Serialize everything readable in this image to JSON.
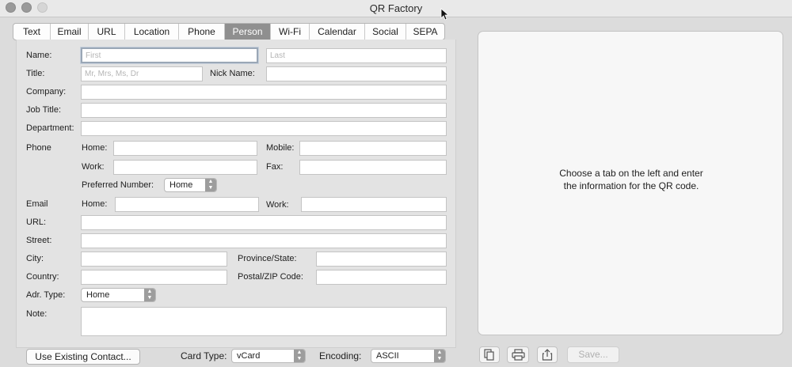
{
  "window": {
    "title": "QR Factory"
  },
  "tabs": [
    "Text",
    "Email",
    "URL",
    "Location",
    "Phone",
    "Person",
    "Wi-Fi",
    "Calendar",
    "Social",
    "SEPA"
  ],
  "selected_tab": "Person",
  "form": {
    "name_label": "Name:",
    "first_placeholder": "First",
    "last_placeholder": "Last",
    "title_label": "Title:",
    "title_placeholder": "Mr, Mrs, Ms, Dr",
    "nickname_label": "Nick Name:",
    "company_label": "Company:",
    "jobtitle_label": "Job Title:",
    "department_label": "Department:",
    "phone_label": "Phone",
    "phone_home_label": "Home:",
    "phone_mobile_label": "Mobile:",
    "phone_work_label": "Work:",
    "phone_fax_label": "Fax:",
    "preferred_label": "Preferred Number:",
    "preferred_value": "Home",
    "email_label": "Email",
    "email_home_label": "Home:",
    "email_work_label": "Work:",
    "url_label": "URL:",
    "street_label": "Street:",
    "city_label": "City:",
    "province_label": "Province/State:",
    "country_label": "Country:",
    "postal_label": "Postal/ZIP Code:",
    "adrtype_label": "Adr. Type:",
    "adrtype_value": "Home",
    "note_label": "Note:"
  },
  "footer": {
    "use_contact_label": "Use Existing Contact...",
    "card_type_label": "Card Type:",
    "card_type_value": "vCard",
    "encoding_label": "Encoding:",
    "encoding_value": "ASCII"
  },
  "preview": {
    "message_line1": "Choose a tab on the left and enter",
    "message_line2": "the information for the QR code.",
    "save_label": "Save..."
  },
  "icons": {
    "copy": "copy-icon",
    "print": "print-icon",
    "share": "share-icon"
  }
}
